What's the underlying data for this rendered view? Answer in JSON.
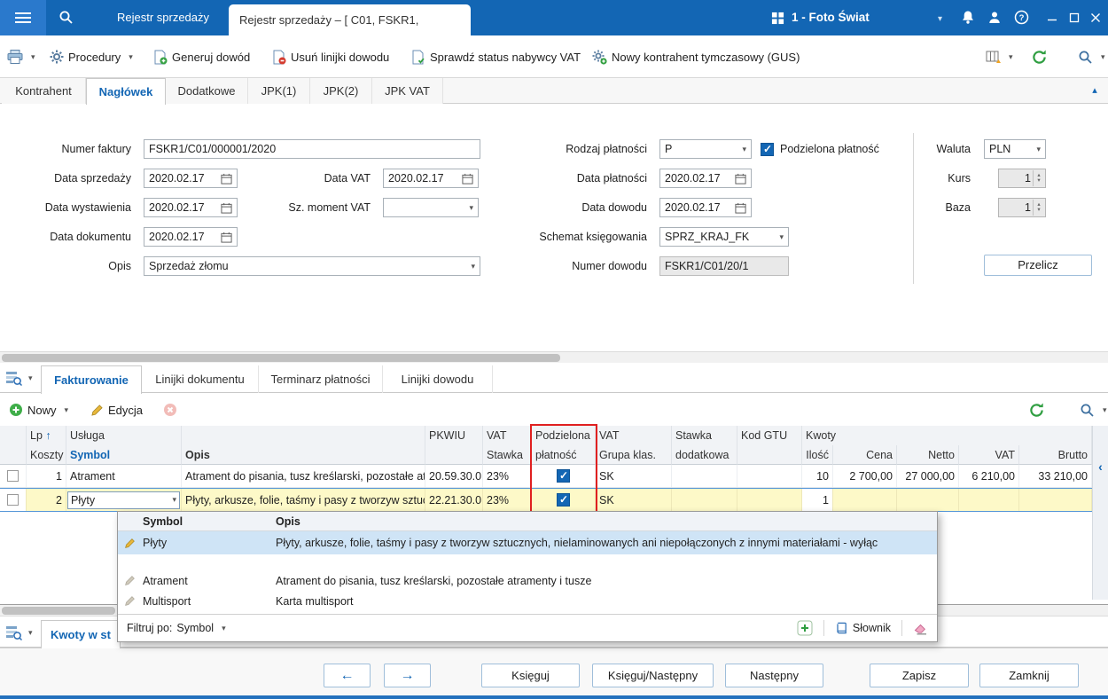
{
  "colors": {
    "accent": "#1366b4",
    "titlebar_blue": "#1366b4",
    "selection_yellow": "#fdf9c8",
    "highlight_red": "#e02020",
    "dropdown_highlight": "#cfe4f6"
  },
  "icons": {
    "chevron_down": "▾",
    "collapse_left": "‹",
    "collapse_up": "▴",
    "check": "✓",
    "sort_asc": "↑",
    "spin_up": "▴",
    "spin_down": "▾"
  },
  "titlebar": {
    "background_tab": "Rejestr sprzedaży",
    "active_tab": "Rejestr sprzedaży – [ C01, FSKR1,",
    "workspace": "1 - Foto Świat"
  },
  "toolbar": {
    "procedury": "Procedury",
    "generuj_dowod": "Generuj dowód",
    "usun_linijki": "Usuń linijki dowodu",
    "sprawdz_status": "Sprawdź status nabywcy VAT",
    "nowy_kontrahent": "Nowy kontrahent tymczasowy (GUS)"
  },
  "tabs": {
    "kontrahent": "Kontrahent",
    "naglowek": "Nagłówek",
    "dodatkowe": "Dodatkowe",
    "jpk1": "JPK(1)",
    "jpk2": "JPK(2)",
    "jpkvat": "JPK VAT"
  },
  "form": {
    "numer_faktury_label": "Numer faktury",
    "numer_faktury": "FSKR1/C01/000001/2020",
    "data_sprzedazy_label": "Data sprzedaży",
    "data_sprzedazy": "2020.02.17",
    "data_wystawienia_label": "Data wystawienia",
    "data_wystawienia": "2020.02.17",
    "data_dokumentu_label": "Data dokumentu",
    "data_dokumentu": "2020.02.17",
    "opis_label": "Opis",
    "opis": "Sprzedaż złomu",
    "data_vat_label": "Data VAT",
    "data_vat": "2020.02.17",
    "sz_moment_vat_label": "Sz. moment VAT",
    "sz_moment_vat": "",
    "rodzaj_platnosci_label": "Rodzaj płatności",
    "rodzaj_platnosci": "P",
    "podzielona_platnosc_label": "Podzielona płatność",
    "podzielona_platnosc_checked": true,
    "data_platnosci_label": "Data płatności",
    "data_platnosci": "2020.02.17",
    "data_dowodu_label": "Data dowodu",
    "data_dowodu": "2020.02.17",
    "schemat_label": "Schemat księgowania",
    "schemat": "SPRZ_KRAJ_FK",
    "numer_dowodu_label": "Numer dowodu",
    "numer_dowodu": "FSKR1/C01/20/1",
    "waluta_label": "Waluta",
    "waluta": "PLN",
    "kurs_label": "Kurs",
    "kurs": "1",
    "baza_label": "Baza",
    "baza": "1",
    "przelicz": "Przelicz"
  },
  "detail_tabs": {
    "fakturowanie": "Fakturowanie",
    "linijki_dokumentu": "Linijki dokumentu",
    "terminarz": "Terminarz płatności",
    "linijki_dowodu": "Linijki dowodu"
  },
  "grid_toolbar": {
    "nowy": "Nowy",
    "edycja": "Edycja"
  },
  "grid": {
    "h": {
      "lp": "Lp",
      "sort": "↑",
      "koszty": "Koszty",
      "usluga": "Usługa",
      "symbol": "Symbol",
      "opis": "Opis",
      "pkwiu": "PKWIU",
      "vat": "VAT",
      "stawka": "Stawka",
      "podzielona": "Podzielona",
      "platnosc": "płatność",
      "vat2": "VAT",
      "grupa": "Grupa klas.",
      "stawka2": "Stawka",
      "dodatkowa": "dodatkowa",
      "kod_gtu": "Kod GTU",
      "kwoty": "Kwoty",
      "ilosc": "Ilość",
      "cena": "Cena",
      "netto": "Netto",
      "vat3": "VAT",
      "brutto": "Brutto"
    },
    "rows": [
      {
        "lp": "1",
        "symbol": "Atrament",
        "opis": "Atrament do pisania, tusz kreślarski, pozostałe atramenty i tusze",
        "pkwiu": "20.59.30.0",
        "stawka": "23%",
        "podzielona": true,
        "grupa": "SK",
        "dodatkowa": "",
        "kod_gtu": "",
        "ilosc": "10",
        "cena": "2 700,00",
        "netto": "27 000,00",
        "vat": "6 210,00",
        "brutto": "33 210,00"
      },
      {
        "lp": "2",
        "symbol": "Płyty",
        "opis": "Płyty, arkusze, folie, taśmy i pasy z tworzyw sztucznych",
        "pkwiu": "22.21.30.0",
        "stawka": "23%",
        "podzielona": true,
        "grupa": "SK",
        "dodatkowa": "",
        "kod_gtu": "",
        "ilosc": "1",
        "cena": "",
        "netto": "",
        "vat": "",
        "brutto": ""
      }
    ]
  },
  "dropdown": {
    "header_symbol": "Symbol",
    "header_opis": "Opis",
    "rows": [
      {
        "symbol": "Płyty",
        "opis": "Płyty, arkusze, folie, taśmy i pasy z tworzyw sztucznych, nielaminowanych ani niepołączonych z innymi materiałami - wyłąc"
      },
      {
        "symbol": "Atrament",
        "opis": "Atrament do pisania, tusz kreślarski, pozostałe atramenty i tusze"
      },
      {
        "symbol": "Multisport",
        "opis": "Karta multisport"
      }
    ],
    "filtruj_po": "Filtruj po:",
    "filter_field": "Symbol",
    "slownik": "Słownik"
  },
  "bottom_pane": {
    "kwoty_tab": "Kwoty w st"
  },
  "footer": {
    "prev": "←",
    "next": "→",
    "ksieguj": "Księguj",
    "ksieguj_nastepny": "Księguj/Następny",
    "nastepny": "Następny",
    "zapisz": "Zapisz",
    "zamknij": "Zamknij"
  }
}
